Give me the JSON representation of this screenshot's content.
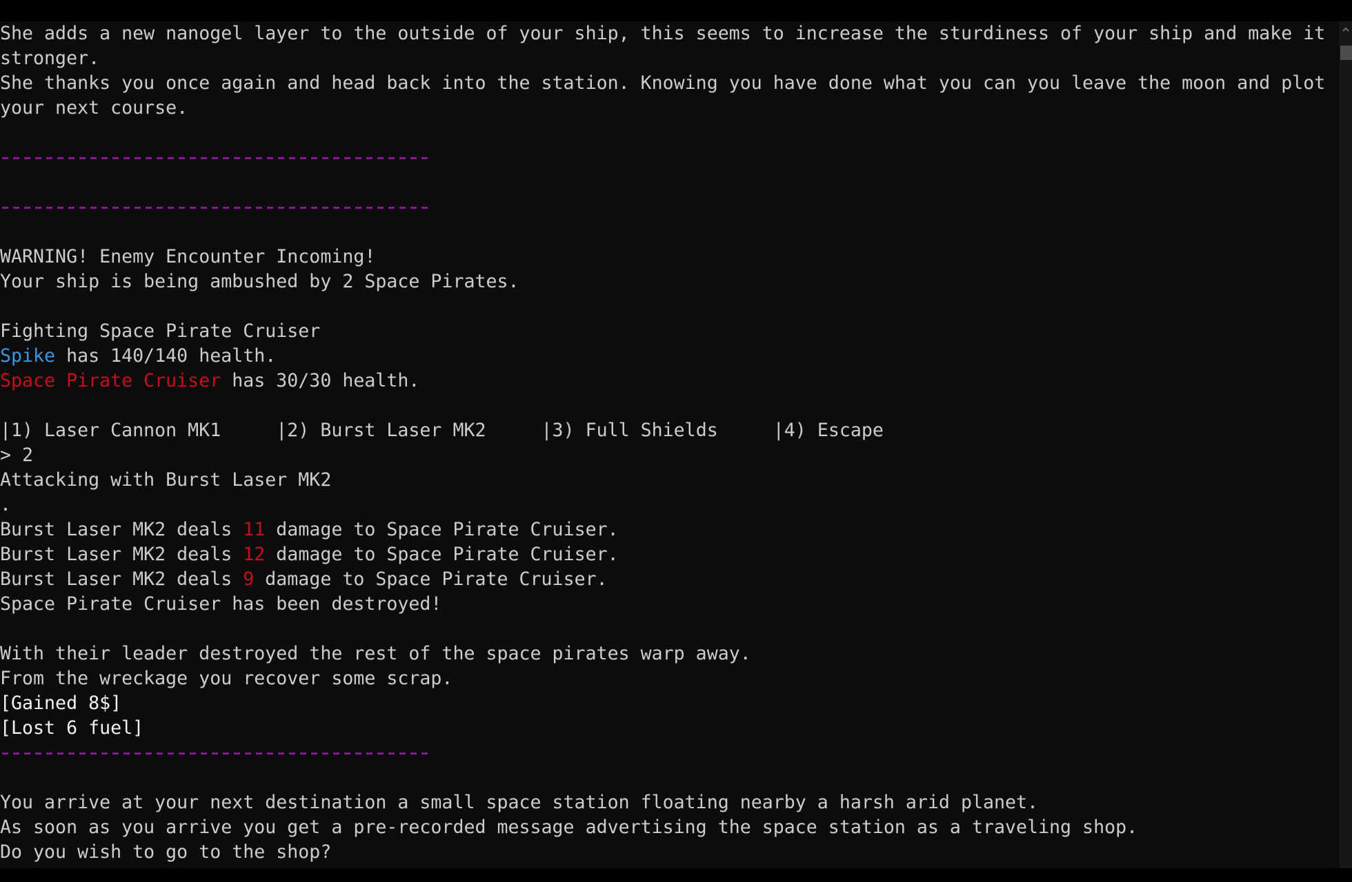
{
  "colors": {
    "background": "#0c0c0c",
    "foreground": "#cccccc",
    "bright_white": "#f2f2f2",
    "blue": "#3a96dd",
    "red": "#c50f1f",
    "separator_purple": "#881798"
  },
  "terminal": {
    "cutoff_line": "",
    "story_intro": {
      "line1": "She adds a new nanogel layer to the outside of your ship, this seems to increase the sturdiness of your ship and make it",
      "line2": "stronger.",
      "line3": "She thanks you once again and head back into the station. Knowing you have done what you can you leave the moon and plot",
      "line4": "your next course."
    },
    "separator": "---------------------------------------",
    "encounter": {
      "warning": "WARNING! Enemy Encounter Incoming!",
      "ambush": "Your ship is being ambushed by 2 Space Pirates."
    },
    "fight": {
      "fighting_line": "Fighting Space Pirate Cruiser",
      "player_name": "Spike",
      "player_health_text": " has 140/140 health.",
      "player_health": {
        "current": 140,
        "max": 140
      },
      "enemy_name": "Space Pirate Cruiser",
      "enemy_health_text": " has 30/30 health.",
      "enemy_health": {
        "current": 30,
        "max": 30
      }
    },
    "action_menu": {
      "options": [
        {
          "key": "1",
          "label": "|1) Laser Cannon MK1     "
        },
        {
          "key": "2",
          "label": "|2) Burst Laser MK2     "
        },
        {
          "key": "3",
          "label": "|3) Full Shields     "
        },
        {
          "key": "4",
          "label": "|4) Escape"
        }
      ]
    },
    "prompt": {
      "symbol": "> ",
      "input": "2"
    },
    "combat_log": {
      "attacking": "Attacking with Burst Laser MK2",
      "progress_dot": ".",
      "hits": [
        {
          "prefix": "Burst Laser MK2 deals ",
          "damage": "11",
          "suffix": " damage to Space Pirate Cruiser."
        },
        {
          "prefix": "Burst Laser MK2 deals ",
          "damage": "12",
          "suffix": " damage to Space Pirate Cruiser."
        },
        {
          "prefix": "Burst Laser MK2 deals ",
          "damage": "9",
          "suffix": " damage to Space Pirate Cruiser."
        }
      ],
      "destroyed": "Space Pirate Cruiser has been destroyed!"
    },
    "aftermath": {
      "line1": "With their leader destroyed the rest of the space pirates warp away.",
      "line2": "From the wreckage you recover some scrap.",
      "gained": "[Gained 8$]",
      "lost": "[Lost 6 fuel]"
    },
    "arrival": {
      "line1": "You arrive at your next destination a small space station floating nearby a harsh arid planet.",
      "line2": "As soon as you arrive you get a pre-recorded message advertising the space station as a traveling shop.",
      "question": "Do you wish to go to the shop?"
    }
  },
  "scrollbar": {
    "up_icon": "chevron-up-icon"
  }
}
